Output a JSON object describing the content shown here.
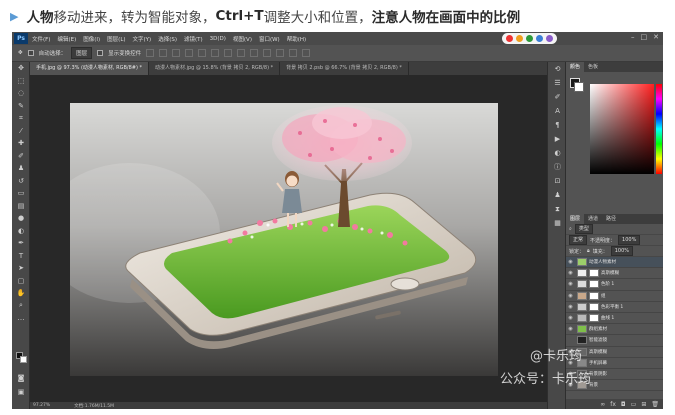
{
  "caption": {
    "part1": "人物",
    "part2": "移动进来，转为智能对象，",
    "part3": "Ctrl+T",
    "part4": "调整大小和位置，",
    "part5": "注意人物在画面中的比例"
  },
  "menubar": {
    "logo": "Ps",
    "items": [
      "文件(F)",
      "编辑(E)",
      "图像(I)",
      "图层(L)",
      "文字(Y)",
      "选择(S)",
      "滤镜(T)",
      "3D(D)",
      "视图(V)",
      "窗口(W)",
      "帮助(H)"
    ]
  },
  "options": {
    "auto_select_label": "自动选择：",
    "auto_select_value": "图层",
    "transform_label": "显示变换控件"
  },
  "tabs": [
    "手机.jpg @ 97.3% (动漫人物素材, RGB/8#) *",
    "动漫人物素材.jpg @ 15.8% (背景 拷贝 2, RGB/8) *",
    "背景 拷贝 2.psb @ 66.7% (背景 拷贝 2, RGB/8) *"
  ],
  "status": {
    "zoom": "97.27%",
    "doc": "文档:1.76M/11.5M"
  },
  "panels": {
    "color_tabs": [
      "颜色",
      "色板"
    ],
    "layer_tabs": [
      "图层",
      "通道",
      "路径"
    ],
    "kind_label": "类型",
    "blend_mode": "正常",
    "opacity_label": "不透明度：",
    "opacity_value": "100%",
    "lock_label": "锁定：",
    "fill_label": "填充：",
    "fill_value": "100%",
    "layers": [
      {
        "name": "动漫人物素材",
        "active": true
      },
      {
        "name": "高斯模糊",
        "active": false
      },
      {
        "name": "色阶 1",
        "active": false
      },
      {
        "name": "组",
        "active": false
      },
      {
        "name": "色彩平衡 1",
        "active": false
      },
      {
        "name": "曲线 1",
        "active": false
      },
      {
        "name": "群组素材",
        "active": false
      },
      {
        "name": "智能滤镜",
        "active": false
      },
      {
        "name": "高斯模糊",
        "active": false
      },
      {
        "name": "手机屏幕",
        "active": false
      },
      {
        "name": "背景阴影",
        "active": false
      },
      {
        "name": "背景",
        "active": false
      }
    ]
  },
  "watermark": {
    "line1": "@卡乐筠",
    "line2": "公众号：卡乐筠"
  }
}
